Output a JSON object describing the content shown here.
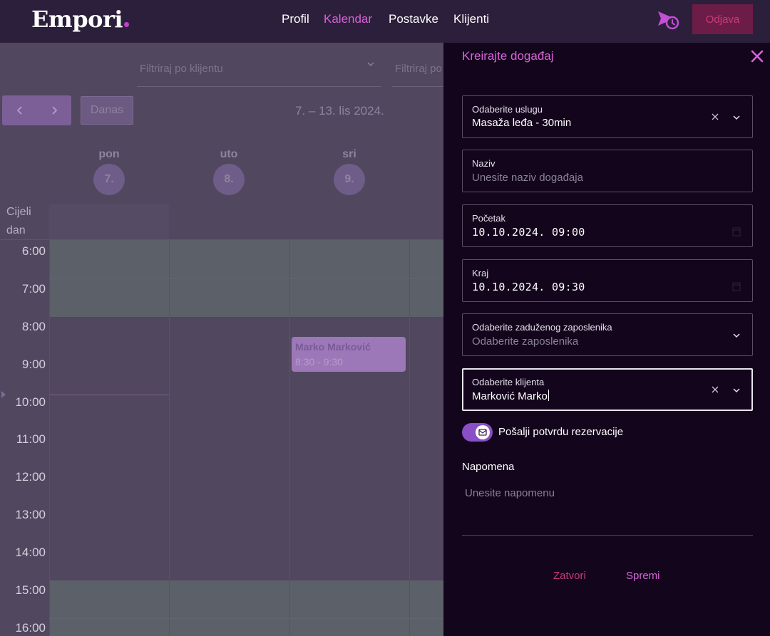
{
  "nav": {
    "logo": "Empori",
    "items": [
      {
        "label": "Profil",
        "active": false
      },
      {
        "label": "Kalendar",
        "active": true
      },
      {
        "label": "Postavke",
        "active": false
      },
      {
        "label": "Klijenti",
        "active": false
      }
    ],
    "logout_label": "Odjava",
    "notification_icon": "calendar-clock-send-icon"
  },
  "calendar": {
    "filters": [
      {
        "placeholder": "Filtriraj po klijentu"
      },
      {
        "placeholder": "Filtriraj po zaposleniku"
      }
    ],
    "today_label": "Danas",
    "date_range": "7. – 13. lis 2024.",
    "days": [
      {
        "name": "pon",
        "num": "7."
      },
      {
        "name": "uto",
        "num": "8."
      },
      {
        "name": "sri",
        "num": "9."
      }
    ],
    "all_day_label": "Cijeli dan",
    "hours": [
      "6:00",
      "7:00",
      "8:00",
      "9:00",
      "10:00",
      "11:00",
      "12:00",
      "13:00",
      "14:00",
      "15:00",
      "16:00"
    ],
    "event": {
      "title": "Marko Marković",
      "time": "8:30 - 9:30"
    }
  },
  "drawer": {
    "title": "Kreirajte događaj",
    "service": {
      "label": "Odaberite uslugu",
      "value": "Masaža leđa - 30min"
    },
    "name": {
      "label": "Naziv",
      "placeholder": "Unesite naziv događaja"
    },
    "start": {
      "label": "Početak",
      "value": "10.10.2024. 09:00"
    },
    "end": {
      "label": "Kraj",
      "value": "10.10.2024. 09:30"
    },
    "employee": {
      "label": "Odaberite zaduženog zaposlenika",
      "placeholder": "Odaberite zaposlenika"
    },
    "client": {
      "label": "Odaberite klijenta",
      "value": "Marković Marko"
    },
    "confirmation_toggle": {
      "label": "Pošalji potvrdu rezervacije",
      "on": true
    },
    "note": {
      "label": "Napomena",
      "placeholder": "Unesite napomenu"
    },
    "close_label": "Zatvori",
    "save_label": "Spremi"
  },
  "colors": {
    "accent": "#d865d8",
    "danger": "#c93a79",
    "toggle": "#8a4ec7",
    "drawer_bg": "#13051c",
    "topbar_bg": "#2c1f3b"
  }
}
